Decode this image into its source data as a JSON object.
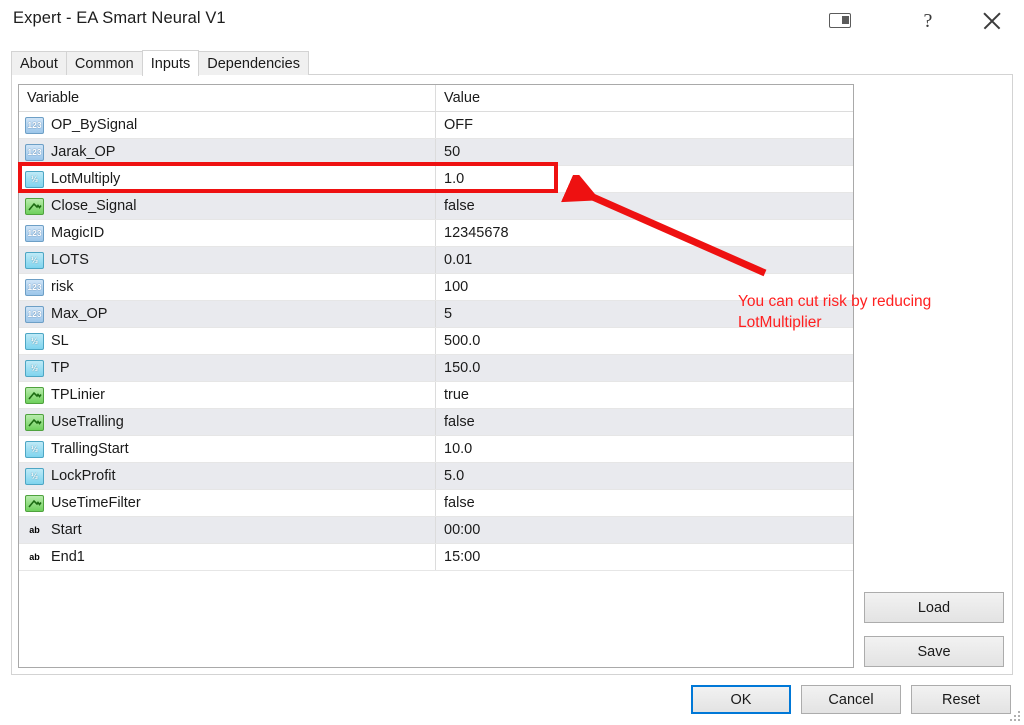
{
  "window": {
    "title": "Expert - EA Smart Neural V1",
    "titlebar_buttons": [
      {
        "name": "screen-icon",
        "label": ""
      },
      {
        "name": "help-icon",
        "label": "?"
      },
      {
        "name": "close-icon",
        "label": ""
      }
    ]
  },
  "tabs": [
    {
      "label": "About",
      "active": false
    },
    {
      "label": "Common",
      "active": false
    },
    {
      "label": "Inputs",
      "active": true
    },
    {
      "label": "Dependencies",
      "active": false
    }
  ],
  "table": {
    "headers": {
      "variable": "Variable",
      "value": "Value"
    },
    "rows": [
      {
        "icon": "int",
        "variable": "OP_BySignal",
        "value": "OFF"
      },
      {
        "icon": "int",
        "variable": "Jarak_OP",
        "value": "50"
      },
      {
        "icon": "float",
        "variable": "LotMultiply",
        "value": "1.0"
      },
      {
        "icon": "bool",
        "variable": "Close_Signal",
        "value": "false"
      },
      {
        "icon": "int",
        "variable": "MagicID",
        "value": "12345678"
      },
      {
        "icon": "float",
        "variable": "LOTS",
        "value": "0.01"
      },
      {
        "icon": "int",
        "variable": "risk",
        "value": "100"
      },
      {
        "icon": "int",
        "variable": "Max_OP",
        "value": "5"
      },
      {
        "icon": "float",
        "variable": "SL",
        "value": "500.0"
      },
      {
        "icon": "float",
        "variable": "TP",
        "value": "150.0"
      },
      {
        "icon": "bool",
        "variable": "TPLinier",
        "value": "true"
      },
      {
        "icon": "bool",
        "variable": "UseTralling",
        "value": "false"
      },
      {
        "icon": "float",
        "variable": "TrallingStart",
        "value": "10.0"
      },
      {
        "icon": "float",
        "variable": "LockProfit",
        "value": "5.0"
      },
      {
        "icon": "bool",
        "variable": "UseTimeFilter",
        "value": "false"
      },
      {
        "icon": "string",
        "variable": "Start",
        "value": "00:00"
      },
      {
        "icon": "string",
        "variable": "End1",
        "value": "15:00"
      }
    ]
  },
  "side_buttons": {
    "load_label": "Load",
    "save_label": "Save"
  },
  "bottom_buttons": {
    "ok_label": "OK",
    "cancel_label": "Cancel",
    "reset_label": "Reset"
  },
  "annotation": {
    "text": "You can cut risk by reducing LotMultiplier",
    "color": "#ff2020",
    "highlight_color": "#ee1111",
    "highlighted_row": "LotMultiply"
  },
  "icon_glyphs": {
    "int": "123",
    "float": "½",
    "bool": "",
    "string": "ab"
  }
}
